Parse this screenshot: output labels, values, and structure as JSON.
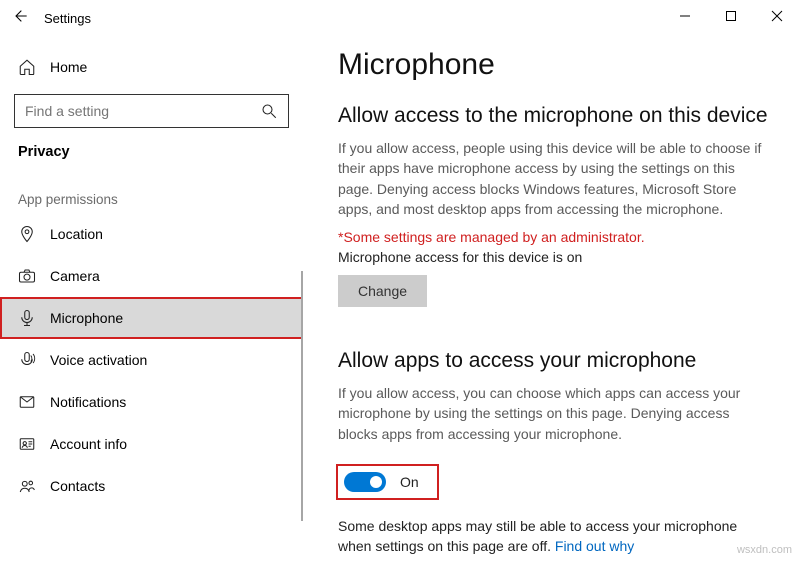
{
  "titlebar": {
    "title": "Settings"
  },
  "sidebar": {
    "home": "Home",
    "search_placeholder": "Find a setting",
    "category": "Privacy",
    "section_label": "App permissions",
    "items": [
      {
        "label": "Location"
      },
      {
        "label": "Camera"
      },
      {
        "label": "Microphone"
      },
      {
        "label": "Voice activation"
      },
      {
        "label": "Notifications"
      },
      {
        "label": "Account info"
      },
      {
        "label": "Contacts"
      }
    ]
  },
  "content": {
    "page_title": "Microphone",
    "section1": {
      "heading": "Allow access to the microphone on this device",
      "body": "If you allow access, people using this device will be able to choose if their apps have microphone access by using the settings on this page. Denying access blocks Windows features, Microsoft Store apps, and most desktop apps from accessing the microphone.",
      "admin_notice": "*Some settings are managed by an administrator.",
      "device_state": "Microphone access for this device is on",
      "change_label": "Change"
    },
    "section2": {
      "heading": "Allow apps to access your microphone",
      "body": "If you allow access, you can choose which apps can access your microphone by using the settings on this page. Denying access blocks apps from accessing your microphone.",
      "toggle_state": "On",
      "note_prefix": "Some desktop apps may still be able to access your microphone when settings on this page are off. ",
      "note_link": "Find out why"
    }
  },
  "watermark": "wsxdn.com"
}
